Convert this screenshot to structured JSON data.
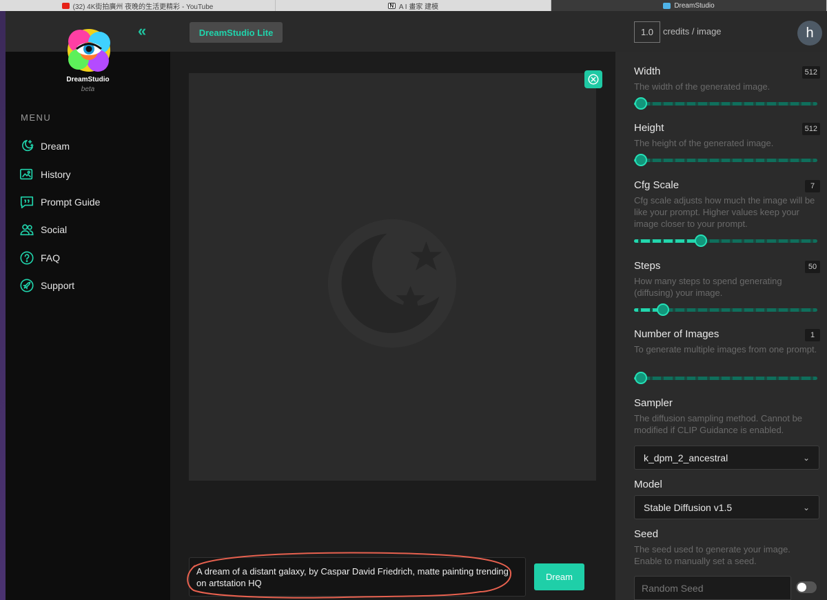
{
  "browser": {
    "tabs": [
      {
        "label": "(32) 4K街拍廣州 夜晚的生活更精彩 - YouTube",
        "favicon": "youtube-icon"
      },
      {
        "label": "A I 畫家 建模",
        "favicon": "notion-icon"
      },
      {
        "label": "DreamStudio",
        "favicon": "dreamstudio-icon"
      }
    ]
  },
  "sidebar": {
    "brand": "DreamStudio",
    "brand_sub": "beta",
    "menu_label": "MENU",
    "items": [
      {
        "label": "Dream",
        "icon": "moon-stars-icon"
      },
      {
        "label": "History",
        "icon": "images-icon"
      },
      {
        "label": "Prompt Guide",
        "icon": "quote-bubble-icon"
      },
      {
        "label": "Social",
        "icon": "users-icon"
      },
      {
        "label": "FAQ",
        "icon": "question-circle-icon"
      },
      {
        "label": "Support",
        "icon": "rocket-circle-icon"
      }
    ]
  },
  "header": {
    "app_badge": "DreamStudio Lite",
    "credits_value": "1.0",
    "credits_label": "credits / image",
    "avatar_letter": "h"
  },
  "main": {
    "prompt": "A dream of a distant galaxy, by Caspar David Friedrich, matte painting trending on artstation HQ",
    "dream_button": "Dream"
  },
  "settings": {
    "width": {
      "title": "Width",
      "value": "512",
      "desc": "The width of the generated image.",
      "fraction": 0.0
    },
    "height": {
      "title": "Height",
      "value": "512",
      "desc": "The height of the generated image.",
      "fraction": 0.0
    },
    "cfg": {
      "title": "Cfg Scale",
      "value": "7",
      "desc": "Cfg scale adjusts how much the image will be like your prompt. Higher values keep your image closer to your prompt.",
      "fraction": 0.35
    },
    "steps": {
      "title": "Steps",
      "value": "50",
      "desc": "How many steps to spend generating (diffusing) your image.",
      "fraction": 0.13
    },
    "num_images": {
      "title": "Number of Images",
      "value": "1",
      "desc": "To generate multiple images from one prompt.",
      "fraction": 0.0
    },
    "sampler": {
      "title": "Sampler",
      "desc": "The diffusion sampling method. Cannot be modified if CLIP Guidance is enabled.",
      "selected": "k_dpm_2_ancestral"
    },
    "model": {
      "title": "Model",
      "selected": "Stable Diffusion v1.5"
    },
    "seed": {
      "title": "Seed",
      "desc": "The seed used to generate your image. Enable to manually set a seed.",
      "placeholder": "Random Seed"
    }
  },
  "colors": {
    "accent": "#1fcfa8",
    "panel": "#2b2b2b",
    "sidebar": "#0d0d0d",
    "annotation": "#e8614f"
  }
}
